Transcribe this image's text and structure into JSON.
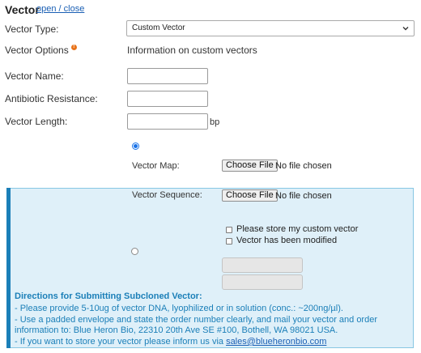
{
  "section": {
    "title": "Vector",
    "toggle_label": "open / close"
  },
  "vector_type": {
    "label": "Vector Type:",
    "selected": "Custom Vector"
  },
  "vector_options": {
    "label": "Vector Options",
    "info_icon": "info-icon",
    "text": "Information on custom vectors"
  },
  "fields": {
    "name_label": "Vector Name:",
    "antibiotic_label": "Antibiotic Resistance:",
    "length_label": "Vector Length:",
    "length_unit": "bp"
  },
  "vector_map": {
    "label": "Vector Map:",
    "button": "Choose File",
    "status": "No file chosen"
  },
  "vector_sequence": {
    "label": "Vector Sequence:",
    "button": "Choose File",
    "status": "No file chosen"
  },
  "checkboxes": {
    "store": "Please store my custom vector",
    "modified": "Vector has been modified"
  },
  "directions": {
    "title": "Directions for Submitting Subcloned Vector:",
    "line1": "- Please provide 5-10ug of vector DNA, lyophilized or in solution (conc.: ~200ng/µl).",
    "line2a": "- Use a padded envelope and state the order number clearly, and mail your vector and order",
    "line2b": "information to: Blue Heron Bio, 22310 20th Ave SE #100, Bothell, WA 98021 USA.",
    "line3_prefix": "- If you want to store your vector please inform us via ",
    "email": "sales@blueheronbio.com"
  },
  "colors": {
    "panel_bg": "#dff0f9",
    "accent": "#1b7fb8",
    "info_icon": "#e8731a"
  }
}
